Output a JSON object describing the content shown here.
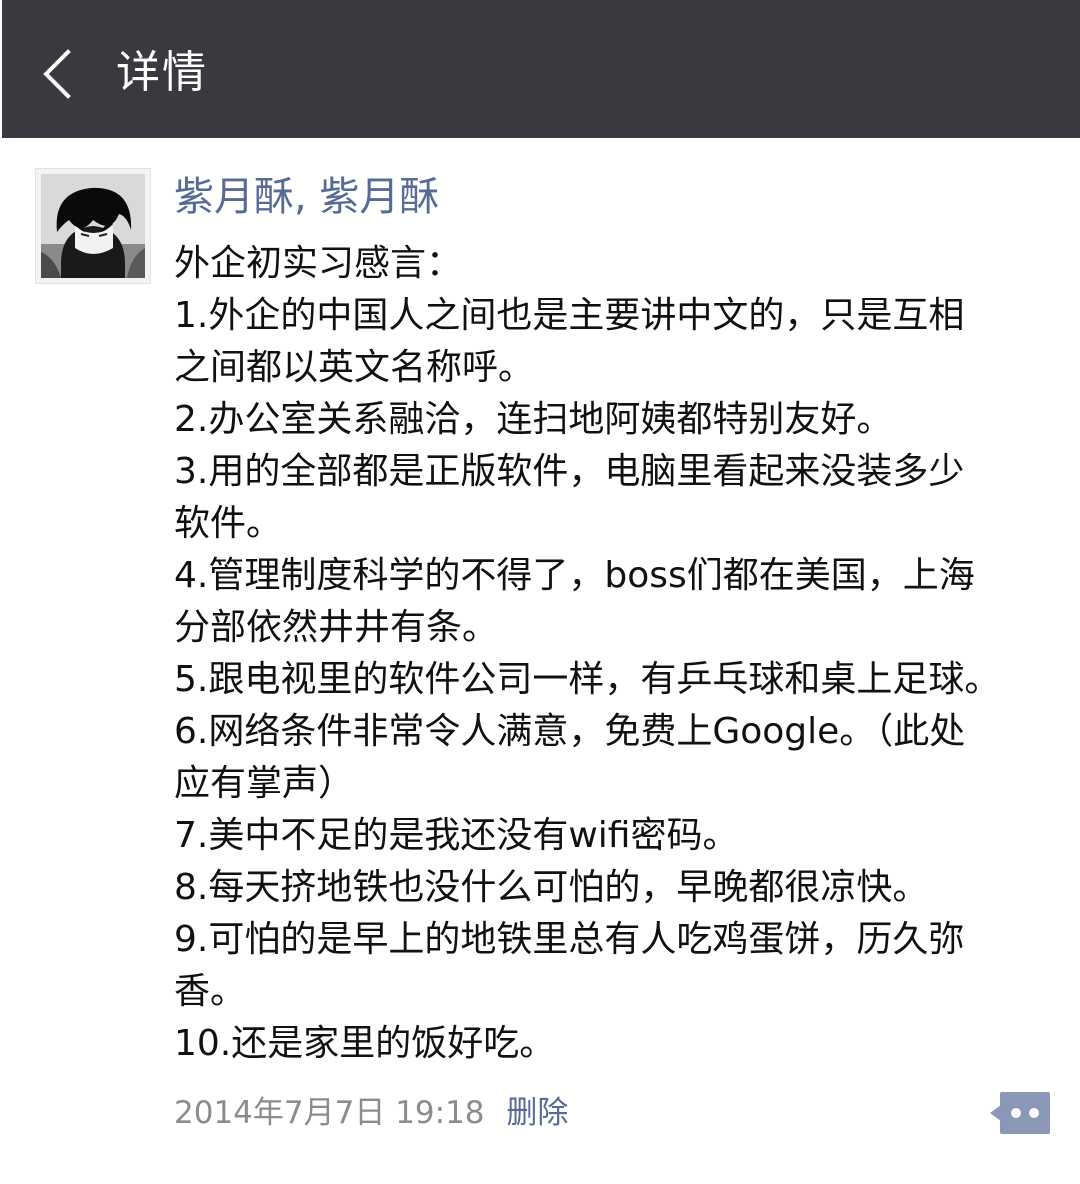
{
  "header": {
    "title": "详情",
    "back_icon": "chevron-left-icon",
    "background": "#393a3f"
  },
  "post": {
    "author": "紫月酥, 紫月酥",
    "lines": [
      "外企初实习感言：",
      "1.外企的中国人之间也是主要讲中文的，只是互相",
      "之间都以英文名称呼。",
      "2.办公室关系融洽，连扫地阿姨都特别友好。",
      "3.用的全部都是正版软件，电脑里看起来没装多少",
      "软件。",
      "4.管理制度科学的不得了，boss们都在美国，上海",
      "分部依然井井有条。",
      "5.跟电视里的软件公司一样，有乒乓球和桌上足球。",
      "6.网络条件非常令人满意，免费上Google。（此处",
      "应有掌声）",
      "7.美中不足的是我还没有wifi密码。",
      "8.每天挤地铁也没什么可怕的，早晚都很凉快。",
      "9.可怕的是早上的地铁里总有人吃鸡蛋饼，历久弥",
      "香。",
      "10.还是家里的饭好吃。"
    ],
    "timestamp": "2014年7月7日 19:18",
    "delete_label": "删除",
    "comment_icon": "comment-more-icon",
    "link_color": "#576b95"
  }
}
